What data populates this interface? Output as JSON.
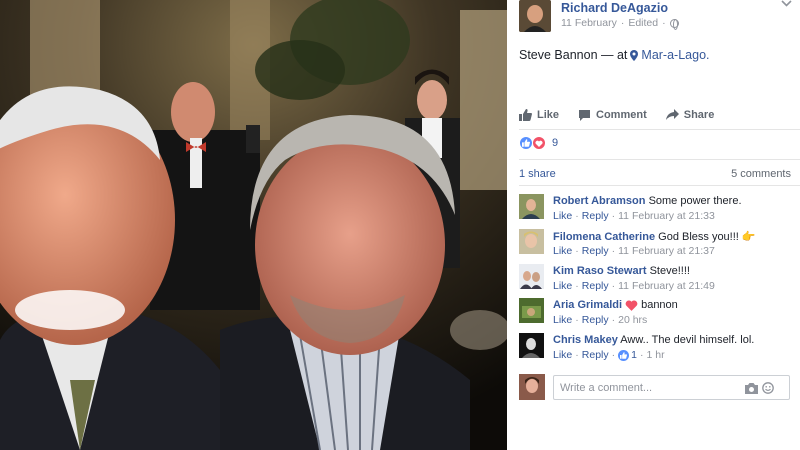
{
  "post": {
    "author": "Richard DeAgazio",
    "date": "11 February",
    "edited": "Edited",
    "separator": "·",
    "text_prefix": "Steve Bannon — at",
    "place": "Mar-a-Lago."
  },
  "actions": {
    "like": "Like",
    "comment": "Comment",
    "share": "Share"
  },
  "stats": {
    "reaction_count": "9",
    "shares": "1 share",
    "comments": "5 comments"
  },
  "comments": [
    {
      "author": "Robert Abramson",
      "text": "Some power there.",
      "like": "Like",
      "reply": "Reply",
      "time": "11 February at 21:33"
    },
    {
      "author": "Filomena Catherine",
      "text": "God Bless you!!!",
      "emoji": "👉",
      "like": "Like",
      "reply": "Reply",
      "time": "11 February at 21:37"
    },
    {
      "author": "Kim Raso Stewart",
      "text": "Steve!!!!",
      "like": "Like",
      "reply": "Reply",
      "time": "11 February at 21:49"
    },
    {
      "author": "Aria Grimaldi",
      "text": "bannon",
      "like": "Like",
      "reply": "Reply",
      "time": "20 hrs"
    },
    {
      "author": "Chris Makey",
      "text": "Aww.. The devil himself. lol.",
      "like": "Like",
      "reply": "Reply",
      "likes": "1",
      "time": "1 hr"
    }
  ],
  "composer": {
    "placeholder": "Write a comment..."
  },
  "colors": {
    "link": "#365899",
    "meta": "#90949c",
    "like_blue": "#5890ff",
    "love_red": "#f25268"
  },
  "icons": [
    "globe-icon",
    "chevron-down-icon",
    "pin-icon",
    "like-icon",
    "comment-icon",
    "share-icon",
    "camera-icon",
    "emoji-icon",
    "heart-icon"
  ]
}
